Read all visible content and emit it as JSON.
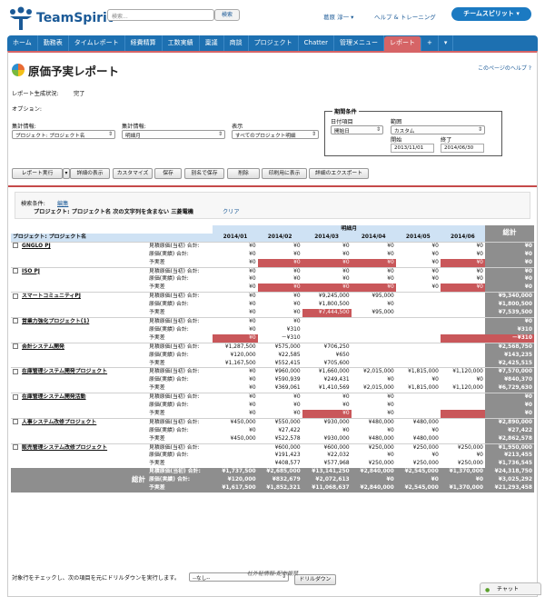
{
  "header": {
    "brand": "TeamSpirit",
    "search_placeholder": "検索...",
    "search_button": "検索",
    "user": "葛原 淳一 ▾",
    "help": "ヘルプ & トレーニング",
    "app_button": "チームスピリット ▾"
  },
  "tabs": [
    "ホーム",
    "勤務表",
    "タイムレポート",
    "経費精算",
    "工数実績",
    "稟議",
    "商談",
    "プロジェクト",
    "Chatter",
    "管理メニュー",
    "レポート",
    "+",
    "▾"
  ],
  "active_tab": "レポート",
  "page": {
    "title": "原価予実レポート",
    "help_link": "このページのヘルプ ?",
    "status_label": "レポート生成状況:",
    "status_value": "完了",
    "options_label": "オプション:"
  },
  "options": {
    "summary1_label": "集計情報:",
    "summary1_value": "プロジェクト: プロジェクト名",
    "summary2_label": "集計情報:",
    "summary2_value": "明細月",
    "display_label": "表示",
    "display_value": "すべてのプロジェクト明細"
  },
  "period": {
    "label": "期間条件",
    "item_label": "日付項目",
    "item_value": "開始日",
    "range_label": "範囲",
    "range_value": "カスタム",
    "start_label": "開始",
    "start_value": "2013/11/01",
    "end_label": "終了",
    "end_value": "2014/06/30"
  },
  "buttons": [
    "レポート実行",
    "▾",
    "詳細の表示",
    "カスタマイズ",
    "保存",
    "別名で保存",
    "削除",
    "印刷用に表示",
    "詳細のエクスポート"
  ],
  "filter": {
    "label": "検索条件:",
    "edit": "編集",
    "text": "プロジェクト: プロジェクト名 次の文字列を含まない 三菱電機",
    "clear": "クリア"
  },
  "table": {
    "group_header": "明細月",
    "project_header": "プロジェクト: プロジェクト名",
    "total_header": "総計",
    "months": [
      "2014/01",
      "2014/02",
      "2014/03",
      "2014/04",
      "2014/05",
      "2014/06"
    ],
    "metrics": [
      "見積原価(当初) 合計:",
      "原価(実績) 合計:",
      "予実差"
    ],
    "rows": [
      {
        "name": "GNGLO PJ",
        "vals": [
          [
            "¥0",
            "¥0",
            "¥0"
          ],
          [
            "¥0",
            "¥0",
            "¥0"
          ],
          [
            "¥0",
            "¥0",
            "¥0"
          ],
          [
            "¥0",
            "¥0",
            "¥0"
          ],
          [
            "¥0",
            "¥0",
            "¥0"
          ],
          [
            "¥0",
            "¥0",
            "¥0"
          ]
        ],
        "total": [
          "¥0",
          "¥0",
          "¥0"
        ],
        "neg": [
          [
            2,
            2
          ],
          [
            3,
            2
          ],
          [
            4,
            2
          ],
          [
            6,
            2
          ]
        ]
      },
      {
        "name": "ISO PJ",
        "vals": [
          [
            "¥0",
            "¥0",
            "¥0"
          ],
          [
            "¥0",
            "¥0",
            "¥0"
          ],
          [
            "¥0",
            "¥0",
            "¥0"
          ],
          [
            "¥0",
            "¥0",
            "¥0"
          ],
          [
            "¥0",
            "¥0",
            "¥0"
          ],
          [
            "¥0",
            "¥0",
            "¥0"
          ]
        ],
        "total": [
          "¥0",
          "¥0",
          "¥0"
        ],
        "neg": [
          [
            2,
            2
          ],
          [
            3,
            2
          ],
          [
            4,
            2
          ],
          [
            6,
            2
          ]
        ]
      },
      {
        "name": "スマートコミュニティPJ",
        "vals": [
          [
            "¥0",
            "¥0",
            "¥0"
          ],
          [
            "¥0",
            "¥0",
            "¥0"
          ],
          [
            "¥9,245,000",
            "¥1,800,500",
            "¥7,444,500"
          ],
          [
            "¥95,000",
            "¥0",
            "¥95,000"
          ],
          [
            "",
            "",
            " "
          ],
          [
            "",
            "",
            ""
          ]
        ],
        "total": [
          "¥9,340,000",
          "¥1,800,500",
          "¥7,539,500"
        ],
        "neg": [
          [
            3,
            2
          ]
        ]
      },
      {
        "name": "営業力強化プロジェクト(1)",
        "vals": [
          [
            "¥0",
            "¥0",
            "¥0"
          ],
          [
            "¥0",
            "¥310",
            "－¥310"
          ],
          [
            "",
            "",
            ""
          ],
          [
            "",
            "",
            ""
          ],
          [
            "",
            "",
            ""
          ],
          [
            "",
            "",
            ""
          ]
        ],
        "total": [
          "¥0",
          "¥310",
          "－¥310"
        ],
        "neg": [
          [
            1,
            2
          ],
          [
            6,
            2
          ]
        ]
      },
      {
        "name": "会計システム開発",
        "vals": [
          [
            "¥1,287,500",
            "¥120,000",
            "¥1,167,500"
          ],
          [
            "¥575,000",
            "¥22,585",
            "¥552,415"
          ],
          [
            "¥706,250",
            "¥650",
            "¥705,600"
          ],
          [
            "",
            "",
            ""
          ],
          [
            "",
            "",
            ""
          ],
          [
            "",
            "",
            ""
          ]
        ],
        "total": [
          "¥2,568,750",
          "¥143,235",
          "¥2,425,515"
        ],
        "neg": []
      },
      {
        "name": "在庫管理システム開発プロジェクト",
        "vals": [
          [
            "¥0",
            "¥0",
            "¥0"
          ],
          [
            "¥960,000",
            "¥590,939",
            "¥369,061"
          ],
          [
            "¥1,660,000",
            "¥249,431",
            "¥1,410,569"
          ],
          [
            "¥2,015,000",
            "¥0",
            "¥2,015,000"
          ],
          [
            "¥1,815,000",
            "¥0",
            "¥1,815,000"
          ],
          [
            "¥1,120,000",
            "¥0",
            "¥1,120,000"
          ]
        ],
        "total": [
          "¥7,570,000",
          "¥840,370",
          "¥6,729,630"
        ],
        "neg": []
      },
      {
        "name": "在庫管理システム開発活動",
        "vals": [
          [
            "¥0",
            "¥0",
            "¥0"
          ],
          [
            "¥0",
            "¥0",
            "¥0"
          ],
          [
            "¥0",
            "¥0",
            "¥0"
          ],
          [
            "¥0",
            "¥0",
            "¥0"
          ],
          [
            "",
            "",
            ""
          ],
          [
            "",
            "",
            ""
          ]
        ],
        "total": [
          "¥0",
          "¥0",
          "¥0"
        ],
        "neg": [
          [
            3,
            2
          ],
          [
            6,
            2
          ]
        ]
      },
      {
        "name": "人事システム改修プロジェクト",
        "vals": [
          [
            "¥450,000",
            "¥0",
            "¥450,000"
          ],
          [
            "¥550,000",
            "¥27,422",
            "¥522,578"
          ],
          [
            "¥930,000",
            "¥0",
            "¥930,000"
          ],
          [
            "¥480,000",
            "¥0",
            "¥480,000"
          ],
          [
            "¥480,000",
            "¥0",
            "¥480,000"
          ],
          [
            "",
            "",
            ""
          ]
        ],
        "total": [
          "¥2,890,000",
          "¥27,422",
          "¥2,862,578"
        ],
        "neg": []
      },
      {
        "name": "販売管理システム改修プロジェクト",
        "vals": [
          [
            "",
            "",
            ""
          ],
          [
            "¥600,000",
            "¥191,423",
            "¥408,577"
          ],
          [
            "¥600,000",
            "¥22,032",
            "¥577,968"
          ],
          [
            "¥250,000",
            "¥0",
            "¥250,000"
          ],
          [
            "¥250,000",
            "¥0",
            "¥250,000"
          ],
          [
            "¥250,000",
            "¥0",
            "¥250,000"
          ]
        ],
        "total": [
          "¥1,950,000",
          "¥213,455",
          "¥1,736,545"
        ],
        "neg": []
      }
    ],
    "grand": {
      "label": "総計",
      "vals": [
        [
          "¥1,737,500",
          "¥120,000",
          "¥1,617,500"
        ],
        [
          "¥2,685,000",
          "¥832,679",
          "¥1,852,321"
        ],
        [
          "¥13,141,250",
          "¥2,072,613",
          "¥11,068,637"
        ],
        [
          "¥2,840,000",
          "¥0",
          "¥2,840,000"
        ],
        [
          "¥2,545,000",
          "¥0",
          "¥2,545,000"
        ],
        [
          "¥1,370,000",
          "¥0",
          "¥1,370,000"
        ]
      ],
      "total": [
        "¥24,318,750",
        "¥3,025,292",
        "¥21,293,458"
      ]
    }
  },
  "footer": {
    "text": "対象行をチェックし、次の項目を元にドリルダウンを実行します。",
    "select": "--なし--",
    "button": "ドリルダウン",
    "confidential": "社外秘情報-配布厳禁",
    "chat": "チャット"
  }
}
